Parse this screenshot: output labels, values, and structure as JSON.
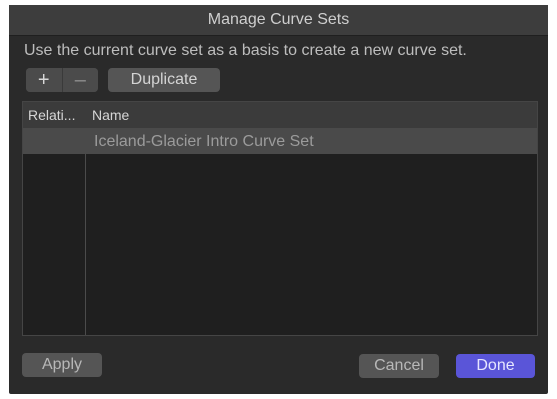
{
  "dialog": {
    "title": "Manage Curve Sets",
    "description": "Use the current curve set as a basis to create a new curve set."
  },
  "toolbar": {
    "add_label": "+",
    "remove_label": "–",
    "duplicate_label": "Duplicate"
  },
  "table": {
    "columns": [
      "Relati...",
      "Name"
    ],
    "rows": [
      {
        "relationship": "",
        "name": "Iceland-Glacier Intro Curve Set",
        "selected": true
      }
    ]
  },
  "footer": {
    "apply_label": "Apply",
    "cancel_label": "Cancel",
    "done_label": "Done"
  },
  "colors": {
    "accent": "#5a55d8",
    "background": "#2a2a2a",
    "selection": "#4a4a4a"
  }
}
